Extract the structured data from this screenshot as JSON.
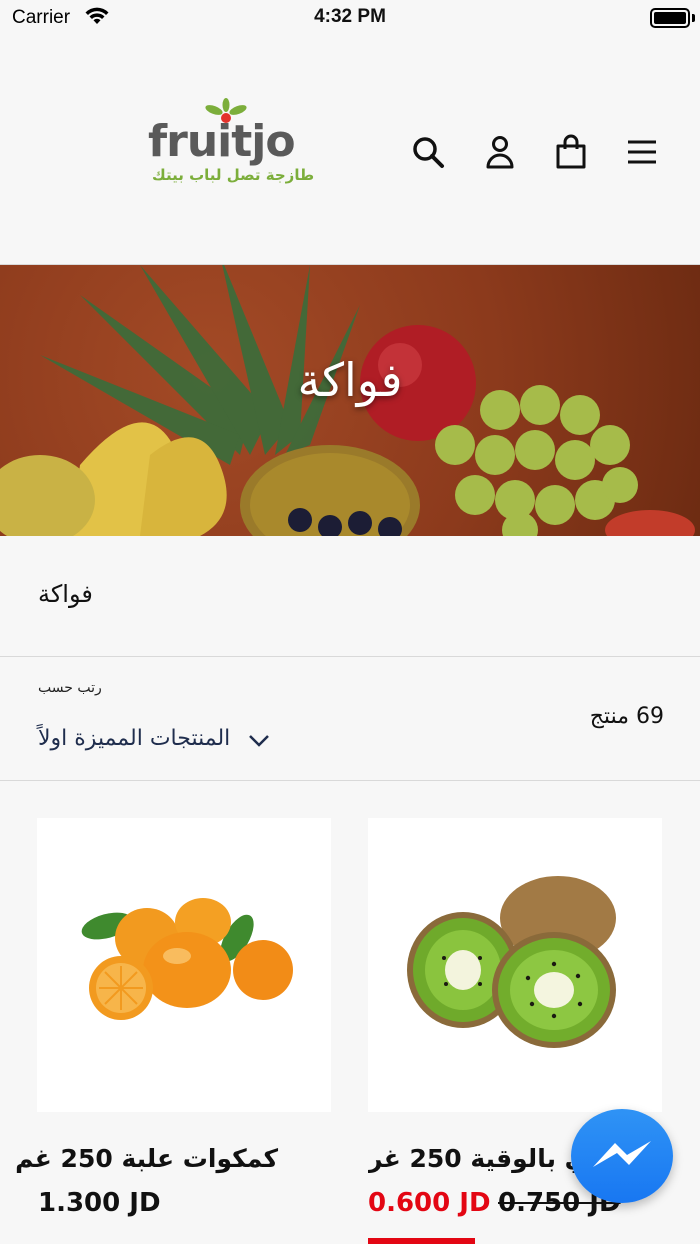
{
  "status_bar": {
    "carrier": "Carrier",
    "time": "4:32 PM"
  },
  "header": {
    "logo_word": "fruitjo",
    "logo_tagline": "طازجة تصل لباب بيتك",
    "icons": [
      "search-icon",
      "account-icon",
      "cart-icon",
      "menu-icon"
    ]
  },
  "hero": {
    "title": "فواكة"
  },
  "collection": {
    "title": "فواكة",
    "sort_label": "رتب حسب",
    "sort_value": "المنتجات المميزة اولاً",
    "product_count": "69 منتج"
  },
  "products": [
    {
      "title": "كمكوات علبة 250 غم",
      "price": "1.300 JD"
    },
    {
      "title": "كيوي بالوقية 250 غرام",
      "sale_price": "0.600 JD",
      "compare_price": "0.750 JD"
    }
  ],
  "colors": {
    "brand_green": "#7cae3b",
    "logo_gray": "#5a5a5a",
    "sale_red": "#e30613",
    "sort_text": "#1f2d4d",
    "messenger_blue": "#1877f2"
  }
}
